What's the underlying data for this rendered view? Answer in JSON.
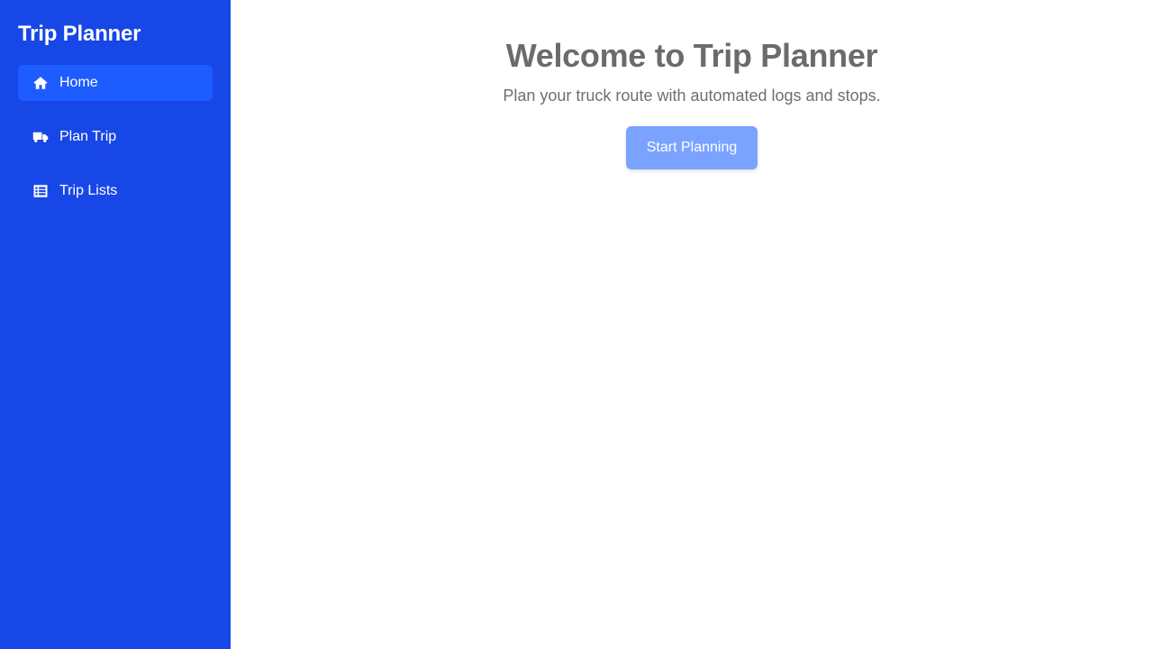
{
  "sidebar": {
    "title": "Trip Planner",
    "items": [
      {
        "label": "Home",
        "icon": "home-icon",
        "active": true
      },
      {
        "label": "Plan Trip",
        "icon": "truck-icon",
        "active": false
      },
      {
        "label": "Trip Lists",
        "icon": "list-icon",
        "active": false
      }
    ]
  },
  "main": {
    "title": "Welcome to Trip Planner",
    "subtitle": "Plan your truck route with automated logs and stops.",
    "cta_label": "Start Planning"
  },
  "colors": {
    "sidebar_bg": "#1747e6",
    "active_item_bg": "#1d5cff",
    "button_bg": "#7aa3ff",
    "heading_text": "#6b6b6b"
  }
}
